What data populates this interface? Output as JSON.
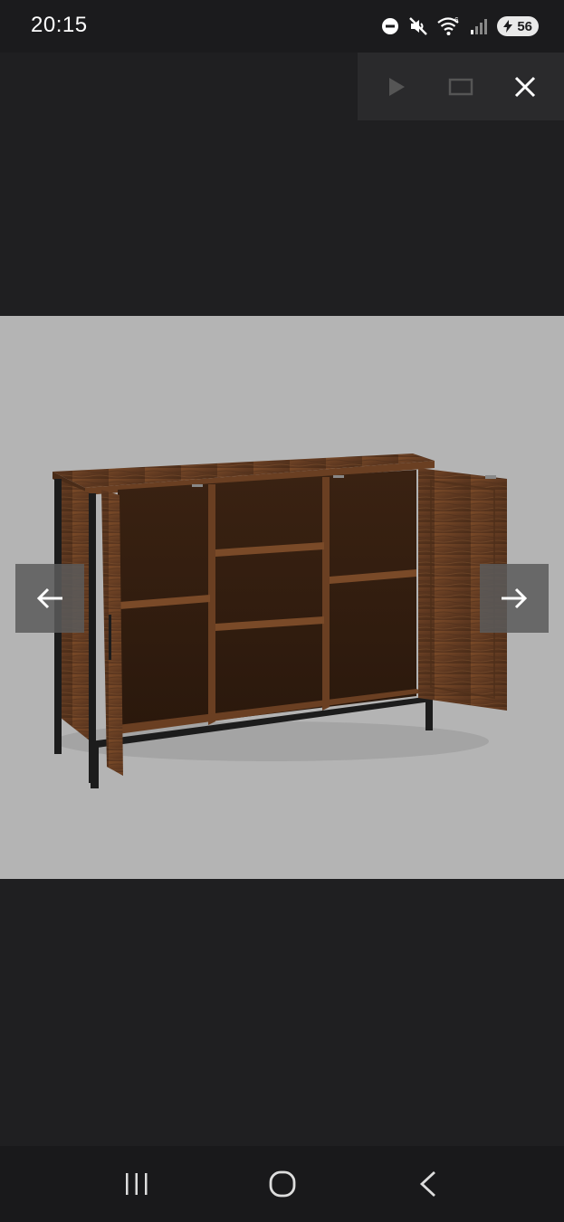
{
  "status_bar": {
    "time": "20:15",
    "battery_level": "56",
    "icons": [
      "do-not-disturb-icon",
      "mute-icon",
      "wifi-icon",
      "signal-icon",
      "battery-icon"
    ]
  },
  "toolbar": {
    "buttons": [
      "slideshow-play-icon",
      "fullscreen-icon",
      "close-icon"
    ]
  },
  "image": {
    "subject": "rustic-brown-wooden-sideboard-cabinet-with-open-doors"
  },
  "gallery_nav": {
    "prev_icon": "arrow-left-icon",
    "next_icon": "arrow-right-icon"
  },
  "system_nav": {
    "buttons": [
      "recent-apps-icon",
      "home-icon",
      "back-icon"
    ]
  },
  "colors": {
    "viewer_background": "#1f1f21",
    "image_background": "#b4b4b4",
    "wood": "#6b3f22",
    "metal_frame": "#1c1c1c"
  }
}
